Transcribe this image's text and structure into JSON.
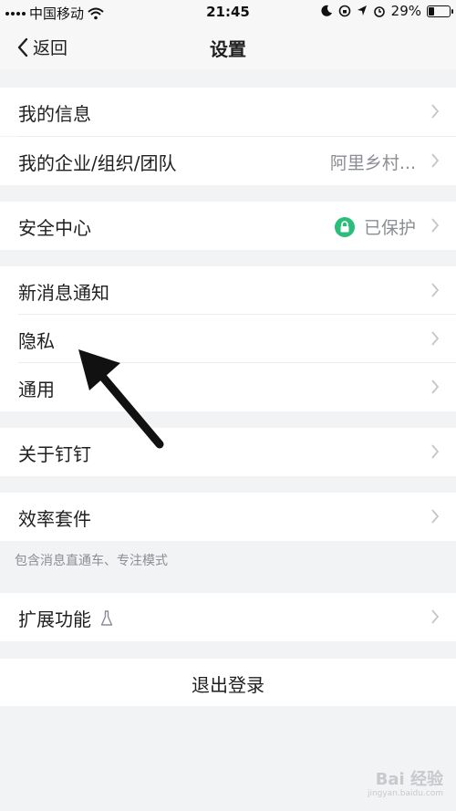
{
  "status_bar": {
    "carrier": "中国移动",
    "time": "21:45",
    "battery": "29%",
    "battery_level": 0.29
  },
  "nav": {
    "back_label": "返回",
    "title": "设置"
  },
  "rows": {
    "my_info": {
      "label": "我的信息"
    },
    "my_org": {
      "label": "我的企业/组织/团队",
      "value": "阿里乡村..."
    },
    "security": {
      "label": "安全中心",
      "value": "已保护"
    },
    "notifications": {
      "label": "新消息通知"
    },
    "privacy": {
      "label": "隐私"
    },
    "general": {
      "label": "通用"
    },
    "about": {
      "label": "关于钉钉"
    },
    "efficiency": {
      "label": "效率套件",
      "hint": "包含消息直通车、专注模式"
    },
    "extensions": {
      "label": "扩展功能"
    }
  },
  "logout": {
    "label": "退出登录"
  },
  "watermark": {
    "text": "Bai 经验",
    "sub": "jingyan.baidu.com"
  },
  "colors": {
    "background": "#f2f3f5",
    "row": "#ffffff",
    "secondary_text": "#8a8d93",
    "secure_green": "#2bbd7a"
  }
}
